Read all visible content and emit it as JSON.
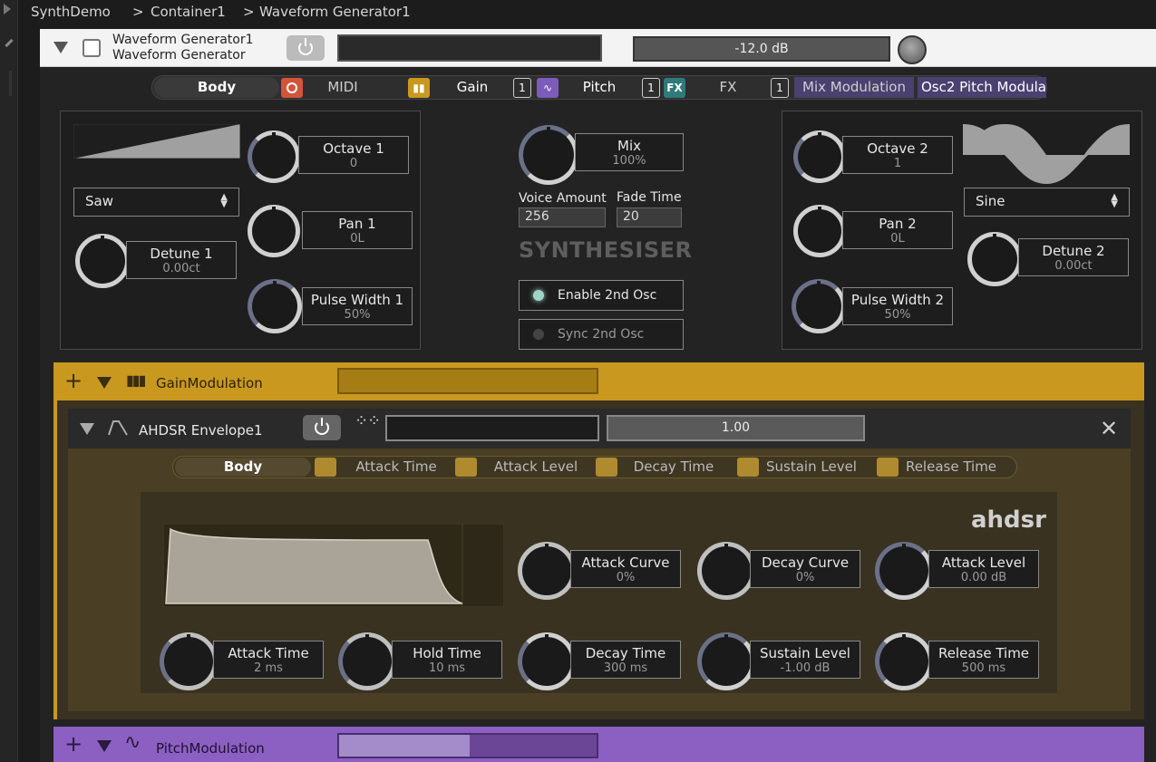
{
  "breadcrumb": {
    "root": "SynthDemo",
    "sep1": ">",
    "item1": "Container1",
    "sep2": ">",
    "item2": "Waveform Generator1"
  },
  "header": {
    "title": "Waveform Generator1",
    "subtitle": "Waveform Generator",
    "level": "-12.0 dB"
  },
  "tabs": {
    "body": "Body",
    "midi": "MIDI",
    "gain": "Gain",
    "gain_count": "1",
    "pitch": "Pitch",
    "pitch_count": "1",
    "fx_tag": "FX",
    "fx": "FX",
    "fx_count": "1",
    "mix_mod": "Mix Modulation",
    "osc2_pitch": "Osc2 Pitch Modula"
  },
  "osc1": {
    "waveform": "Saw",
    "octave": {
      "label": "Octave 1",
      "value": "0"
    },
    "pan": {
      "label": "Pan 1",
      "value": "0L"
    },
    "detune": {
      "label": "Detune 1",
      "value": "0.00ct"
    },
    "pulse": {
      "label": "Pulse Width 1",
      "value": "50%"
    }
  },
  "center": {
    "mix": {
      "label": "Mix",
      "value": "100%"
    },
    "voice_amount_label": "Voice Amount",
    "voice_amount": "256",
    "fade_time_label": "Fade Time",
    "fade_time": "20",
    "title": "SYNTHESISER",
    "enable_2nd": "Enable 2nd Osc",
    "sync_2nd": "Sync 2nd Osc",
    "enable_2nd_on": true,
    "sync_2nd_on": false
  },
  "osc2": {
    "waveform": "Sine",
    "octave": {
      "label": "Octave 2",
      "value": "1"
    },
    "pan": {
      "label": "Pan 2",
      "value": "0L"
    },
    "detune": {
      "label": "Detune 2",
      "value": "0.00ct"
    },
    "pulse": {
      "label": "Pulse Width 2",
      "value": "50%"
    }
  },
  "gain_modulation": {
    "title": "GainModulation",
    "color": "#c9981f"
  },
  "ahdsr": {
    "title": "AHDSR Envelope1",
    "value": "1.00",
    "brand": "ahdsr",
    "tabs": {
      "body": "Body",
      "attack_time": "Attack Time",
      "attack_level": "Attack Level",
      "decay_time": "Decay Time",
      "sustain_level": "Sustain Level",
      "release_time": "Release Time"
    },
    "attack_curve": {
      "label": "Attack Curve",
      "value": "0%"
    },
    "decay_curve": {
      "label": "Decay Curve",
      "value": "0%"
    },
    "attack_level": {
      "label": "Attack Level",
      "value": "0.00 dB"
    },
    "attack_time": {
      "label": "Attack Time",
      "value": "2 ms"
    },
    "hold_time": {
      "label": "Hold Time",
      "value": "10 ms"
    },
    "decay_time": {
      "label": "Decay Time",
      "value": "300 ms"
    },
    "sustain_level": {
      "label": "Sustain Level",
      "value": "-1.00 dB"
    },
    "release_time": {
      "label": "Release Time",
      "value": "500 ms"
    }
  },
  "pitch_modulation": {
    "title": "PitchModulation",
    "color": "#8c5fc2"
  }
}
